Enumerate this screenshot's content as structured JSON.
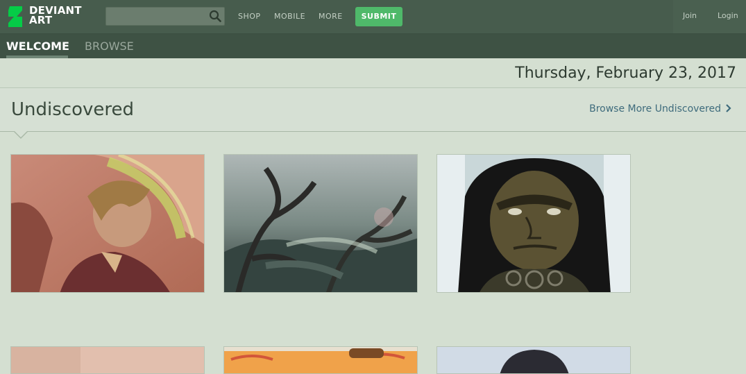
{
  "header": {
    "logo_line1": "DEVIANT",
    "logo_line2": "ART",
    "search_placeholder": "",
    "nav": [
      "SHOP",
      "MOBILE",
      "MORE"
    ],
    "submit_label": "SUBMIT",
    "join_label": "Join",
    "login_label": "Login"
  },
  "tabs": {
    "welcome": "WELCOME",
    "browse": "BROWSE"
  },
  "date": "Thursday, February 23, 2017",
  "section": {
    "title": "Undiscovered",
    "browse_more": "Browse More Undiscovered"
  },
  "colors": {
    "topbar": "#475c4d",
    "submit": "#4fb96a",
    "background": "#d4dfd1",
    "link": "#3e6b7c"
  },
  "icons": {
    "logo": "deviantart-logo-icon",
    "search": "search-icon",
    "chevron": "chevron-right-icon"
  }
}
